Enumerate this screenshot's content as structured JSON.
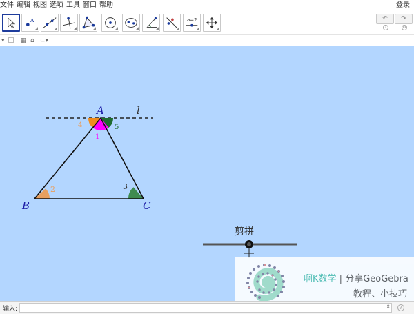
{
  "menu": {
    "items": [
      "文件",
      "编辑",
      "视图",
      "选项",
      "工具",
      "窗口",
      "帮助"
    ],
    "login": "登录"
  },
  "toolbar": {
    "tools": [
      {
        "name": "move-tool",
        "icon": "arrow-pointer-icon"
      },
      {
        "name": "point-tool",
        "icon": "point-icon"
      },
      {
        "name": "line-tool",
        "icon": "line-icon"
      },
      {
        "name": "perpendicular-line-tool",
        "icon": "perpendicular-icon"
      },
      {
        "name": "polygon-tool",
        "icon": "polygon-icon"
      },
      {
        "name": "circle-tool",
        "icon": "circle-icon"
      },
      {
        "name": "conic-tool",
        "icon": "ellipse-icon"
      },
      {
        "name": "angle-tool",
        "icon": "angle-icon"
      },
      {
        "name": "reflect-tool",
        "icon": "reflect-icon"
      },
      {
        "name": "slider-tool",
        "icon": "slider-icon"
      },
      {
        "name": "move-graphics-view-tool",
        "icon": "move-arrows-icon"
      }
    ],
    "slider_icon_text": "a=2",
    "undo": "↶",
    "redo": "↷"
  },
  "construction": {
    "points": {
      "A": "A",
      "B": "B",
      "C": "C"
    },
    "line_label": "l",
    "angle_labels": {
      "a1": "1",
      "a2": "2",
      "a3": "3",
      "a4": "4",
      "a5": "5"
    },
    "colors": {
      "background": "#b3d6ff",
      "angle_orange": "#e8a060",
      "angle_green": "#2e7d3e",
      "angle_magenta": "#ff00ff",
      "point_label": "#1a1aa6"
    }
  },
  "slider": {
    "label": "剪拼",
    "value": 0.5
  },
  "watermark": {
    "brand": "啊K数学",
    "separator": " | ",
    "line1_rest": "分享GeoGebra",
    "line2": "教程、小技巧"
  },
  "inputbar": {
    "label": "输入:",
    "value": ""
  }
}
